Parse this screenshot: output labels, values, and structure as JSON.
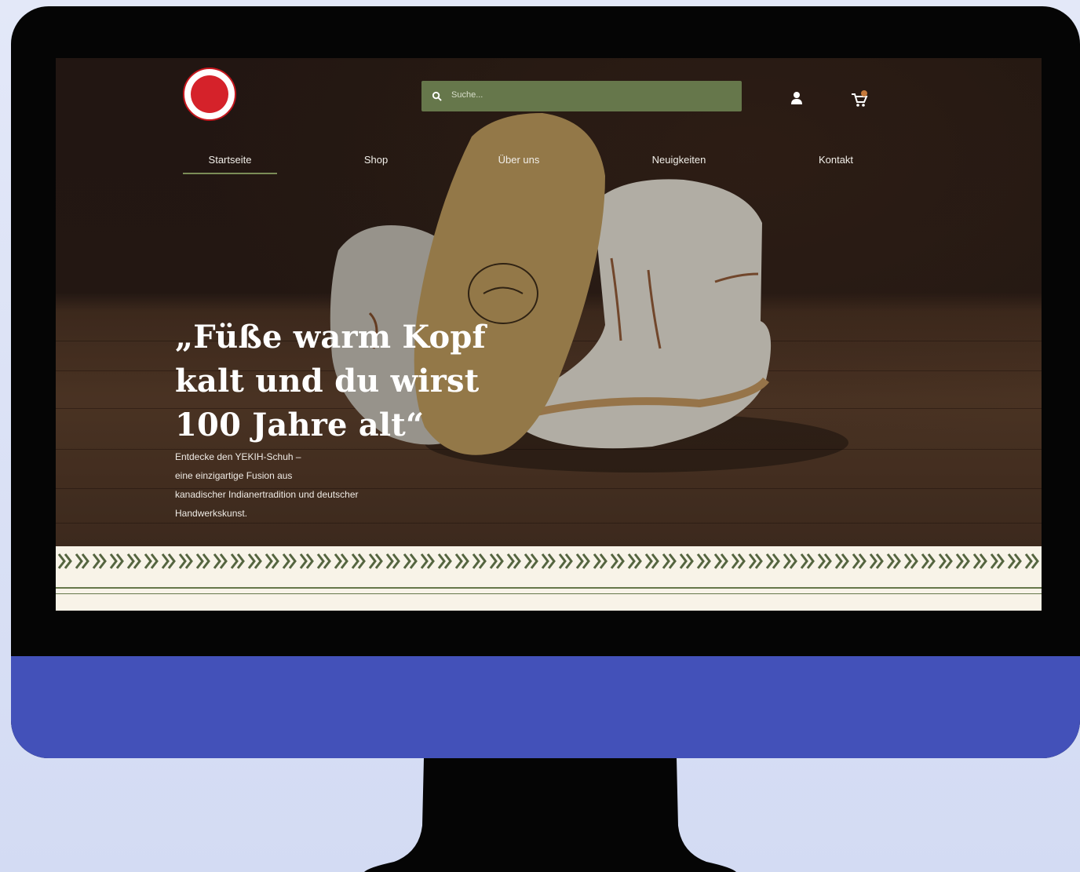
{
  "search": {
    "placeholder": "Suche..."
  },
  "nav": {
    "items": [
      "Startseite",
      "Shop",
      "Über uns",
      "Neuigkeiten",
      "Kontakt"
    ]
  },
  "hero": {
    "headline": [
      "„Füße warm Kopf",
      "kalt und du wirst",
      "100 Jahre alt“"
    ],
    "subtext": "Entdecke den YEKIH-Schuh –\neine einzigartige Fusion aus\nkanadischer Indianertradition und deutscher\nHandwerkskunst."
  },
  "colors": {
    "brand_red": "#d5222a",
    "accent_green": "#66774b",
    "chin_blue": "#4351b9",
    "band_bg": "#f8f3e8"
  },
  "icons": [
    "search-icon",
    "user-icon",
    "cart-icon"
  ]
}
